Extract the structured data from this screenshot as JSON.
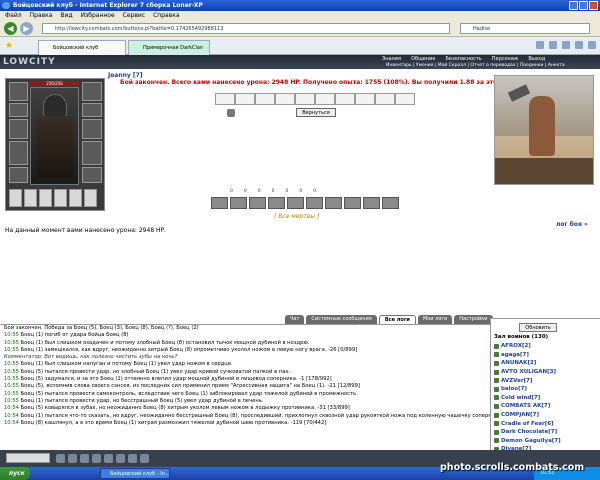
{
  "window": {
    "title": "Бойцовский клуб - Internet Explorer 7 сборка Loner-XP"
  },
  "menu": [
    "Файл",
    "Правка",
    "Вид",
    "Избранное",
    "Сервис",
    "Справка"
  ],
  "address": {
    "url": "http://lowcity.combats.com/buttons.pl?battle=0.174265492988113",
    "search": "Hadise"
  },
  "tabs": [
    {
      "label": "Бойцовский клуб"
    },
    {
      "label": "Примерочная DarkClan"
    }
  ],
  "site": {
    "logo": "LOWCITY",
    "nav": [
      "Знания",
      "Общение",
      "Безопасность",
      "Персонаж",
      "Выход"
    ],
    "subnav": "Инвентарь | Умения | Мой Скролл | Отчет о переводах | Поединки | Анкета"
  },
  "battle": {
    "player": "Jeanny [7]",
    "hp": "256/256",
    "result": "Бой закончен. Всего вами нанесено урона: 2948 HP. Получено опыта: 1755 (108%). Вы получили 1.88 за этот бой.",
    "return_btn": "Вернуться",
    "stats": [
      "0",
      "0",
      "0",
      "0",
      "0",
      "0",
      "0"
    ],
    "dead_link": "[ Все мертвы ]",
    "log_link": "лог боя »",
    "damage_line": "На данный момент вами нанесено урона: 2948 HP."
  },
  "chat": {
    "tabs": [
      "Чат",
      "Системные сообщения",
      "Все логи",
      "Мои логи",
      "Настройки"
    ],
    "active_tab": "Все логи",
    "lines": [
      {
        "time": "",
        "text": "Бой закончен. Победа за Боец (5), Боец (3), Боец (8), Боец (?), Боец (2)",
        "italic": false
      },
      {
        "time": "10:55",
        "text": "Боец (1) погиб от удара бойца Боец (8)",
        "italic": false
      },
      {
        "time": "10:55",
        "text": "Боец (1) был слишком озадачен и потому злобный Боец (8) остановил тычок мощной дубиной в ноздрю.",
        "italic": false
      },
      {
        "time": "10:55",
        "text": "Боец (1) замешкался, как вдруг, неожиданно хитрый Боец (8) опрометчиво уколол ножом в левую ногу врага. -26 [0/899]",
        "italic": false
      },
      {
        "time": "",
        "text": "Комментатор: Вот видишь, как полезно чистить зубы на ночь?",
        "italic": true
      },
      {
        "time": "10:55",
        "text": "Боец (1) был слишком напуган и потому Боец (1) увел удар ножом в сердце.",
        "italic": false
      },
      {
        "time": "10:55",
        "text": "Боец (5) пытался провести удар, но злобный Боец (1) увел удар кривой сучковатой палкой в пах.",
        "italic": false
      },
      {
        "time": "10:55",
        "text": "Боец (5) задумался, и за это Боец (1) отчаянно влепил удар мощной дубиной в пищевод соперника. -1 [178/992]",
        "italic": false
      },
      {
        "time": "10:55",
        "text": "Боец (5), вспомнив слова своего сэнсея, из последних сил применил прием \"Агрессивная защита\" на Боец (1). -21 [12/899]",
        "italic": false
      },
      {
        "time": "10:55",
        "text": "Боец (5) пытался провести самоконтроль, вследствие чего Боец (1) заблокировал удар тяжелой дубиной в промежность.",
        "italic": false
      },
      {
        "time": "10:55",
        "text": "Боец (1) пытался провести удар, но бесстрашный Боец (5) увел удар дубиной в печень.",
        "italic": false
      },
      {
        "time": "10:54",
        "text": "Боец (5) ковырялся в зубах, но неожиданно Боец (8) хитрым уколом левым ножом в лодыжку противника. -31 [33/899]",
        "italic": false
      },
      {
        "time": "10:54",
        "text": "Боец (1) пытался что-то сказать, но вдруг, неожиданно бесстрашный Боец (8), проследивший, прихлопнул сквозной удар рукояткой ножа под коленную чашечку соперника. -21 [64/899]",
        "italic": false
      },
      {
        "time": "10:54",
        "text": "Боец (8) кашлянул, а в это время Боец (1) хитрая размозжил тяжелой дубиной шею противника. -119 [70/442]",
        "italic": false
      }
    ]
  },
  "side": {
    "refresh": "Обновить",
    "header": "Зал воинов (130)",
    "players": [
      "AFROX[2]",
      "agaga[7]",
      "ANUNAK[2]",
      "AVTO XULIGAN[3]",
      "AVZVer[7]",
      "baloo[7]",
      "Cold wind[7]",
      "COMBATS AK[7]",
      "COMPJAN[7]",
      "Cradle of Fear[6]",
      "Dark Chocolate[7]",
      "Demon Gaguilya[7]",
      "Divane[7]"
    ]
  },
  "taskbar": {
    "start": "пуск",
    "task": "Бойцовский клуб - In...",
    "tray": "10:55"
  },
  "watermark": "photo.scrolls.combats.com"
}
